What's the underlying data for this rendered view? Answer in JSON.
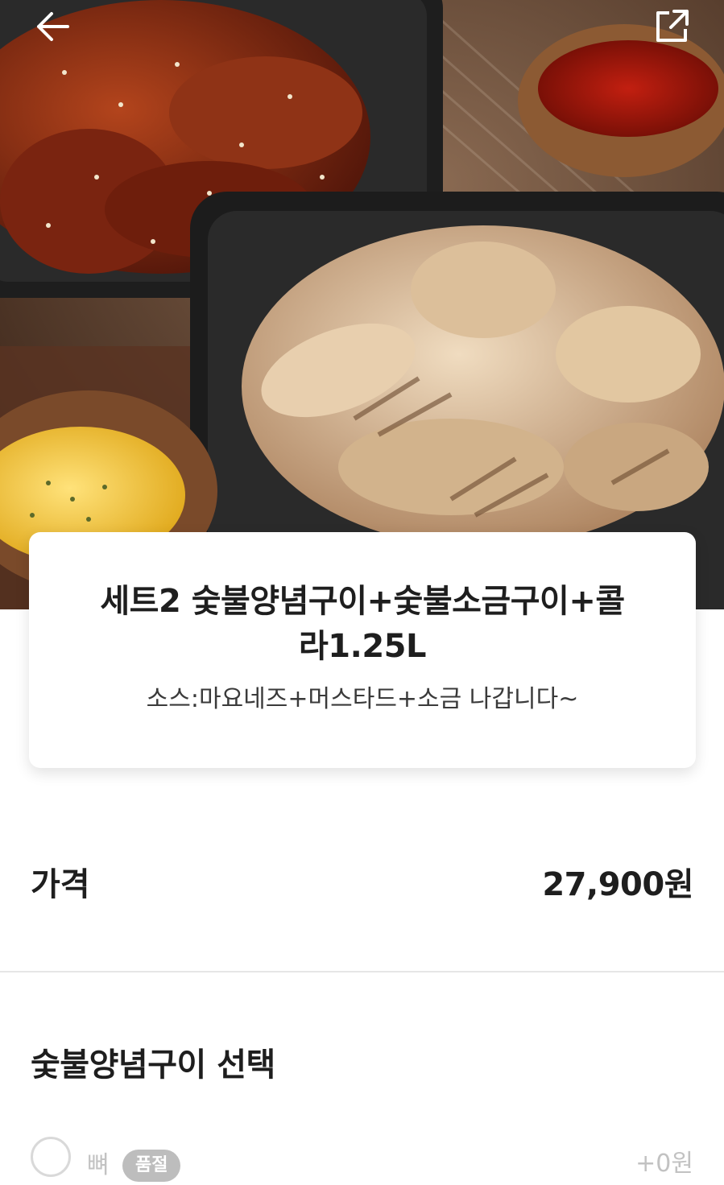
{
  "header": {
    "back_icon": "arrow-left-icon",
    "share_icon": "share-external-icon"
  },
  "menu": {
    "name": "세트2 숯불양념구이+숯불소금구이+콜라1.25L",
    "description": "소스:마요네즈+머스타드+소금 나갑니다~"
  },
  "price": {
    "label": "가격",
    "value": "27,900원"
  },
  "option_group": {
    "title": "숯불양념구이 선택",
    "options": [
      {
        "label": "뼈",
        "badge": "품절",
        "price": "+0원",
        "selected": false
      }
    ]
  },
  "colors": {
    "text_primary": "#1e1e1e",
    "text_disabled": "#c2c2c2",
    "badge_bg": "#bdbdbd",
    "divider": "#e6e6e6"
  }
}
